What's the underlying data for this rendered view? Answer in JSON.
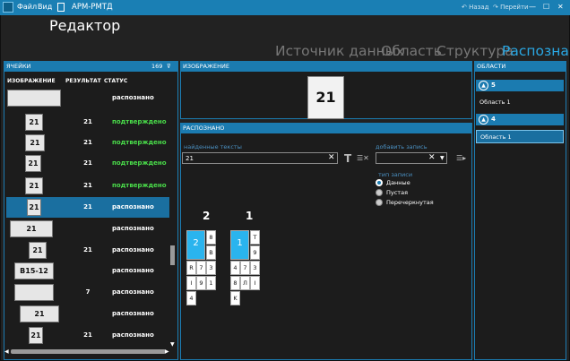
{
  "app": {
    "menu_file": "Файл",
    "menu_view": "Вид",
    "title": "АРМ-РМТД",
    "back": "Назад",
    "forward": "Перейти",
    "minimize": "—",
    "maximize": "☐",
    "close": "✕"
  },
  "page": {
    "heading": "Редактор"
  },
  "nav": {
    "items": [
      "Источник данных",
      "Область",
      "Структура",
      "Распознано"
    ],
    "active_index": 3
  },
  "cells": {
    "title": "ЯЧЕЙКИ",
    "count": "169",
    "columns": [
      "ИЗОБРАЖЕНИЕ",
      "РЕЗУЛЬТАТ",
      "СТАТУС"
    ],
    "rows": [
      {
        "img": "",
        "result": "",
        "status": "распознано",
        "confirmed": false
      },
      {
        "img": "21",
        "result": "21",
        "status": "подтверждено",
        "confirmed": true
      },
      {
        "img": "21",
        "result": "21",
        "status": "подтверждено",
        "confirmed": true
      },
      {
        "img": "21",
        "result": "21",
        "status": "подтверждено",
        "confirmed": true
      },
      {
        "img": "21",
        "result": "21",
        "status": "подтверждено",
        "confirmed": true
      },
      {
        "img": "21",
        "result": "21",
        "status": "распознано",
        "confirmed": false,
        "selected": true
      },
      {
        "img": "21",
        "result": "",
        "status": "распознано",
        "confirmed": false
      },
      {
        "img": "21",
        "result": "21",
        "status": "распознано",
        "confirmed": false
      },
      {
        "img": "B15-12",
        "result": "",
        "status": "распознано",
        "confirmed": false
      },
      {
        "img": "",
        "result": "7",
        "status": "распознано",
        "confirmed": false
      },
      {
        "img": "21",
        "result": "",
        "status": "распознано",
        "confirmed": false
      },
      {
        "img": "21",
        "result": "21",
        "status": "распознано",
        "confirmed": false
      }
    ]
  },
  "image_panel": {
    "title": "ИЗОБРАЖЕНИЕ",
    "preview_text": "21"
  },
  "recognized": {
    "title": "РАСПОЗНАНО",
    "found_label": "найденные тексты",
    "found_value": "21",
    "add_label": "добавить запись",
    "add_value": "",
    "type_label": "тип записи",
    "radios": [
      {
        "label": "Данные",
        "checked": true
      },
      {
        "label": "Пустая",
        "checked": false
      },
      {
        "label": "Перечеркнутая",
        "checked": false
      }
    ],
    "group_left": {
      "label": "2",
      "cells": [
        "2",
        "8",
        "B",
        "R",
        "7",
        "3",
        "I",
        "9",
        "1",
        "4"
      ]
    },
    "group_right": {
      "label": "1",
      "cells": [
        "1",
        "T",
        "9",
        "4",
        "7",
        "3",
        "8",
        "Л",
        "I",
        "K"
      ]
    }
  },
  "areas": {
    "title": "ОБЛАСТИ",
    "groups": [
      {
        "num": "5",
        "items": [
          "Область 1"
        ]
      },
      {
        "num": "4",
        "items": [
          "Область 1"
        ]
      }
    ]
  },
  "colors": {
    "accent": "#1b7bb0",
    "confirmed": "#4ade4a",
    "active_nav": "#2aa8e4"
  }
}
